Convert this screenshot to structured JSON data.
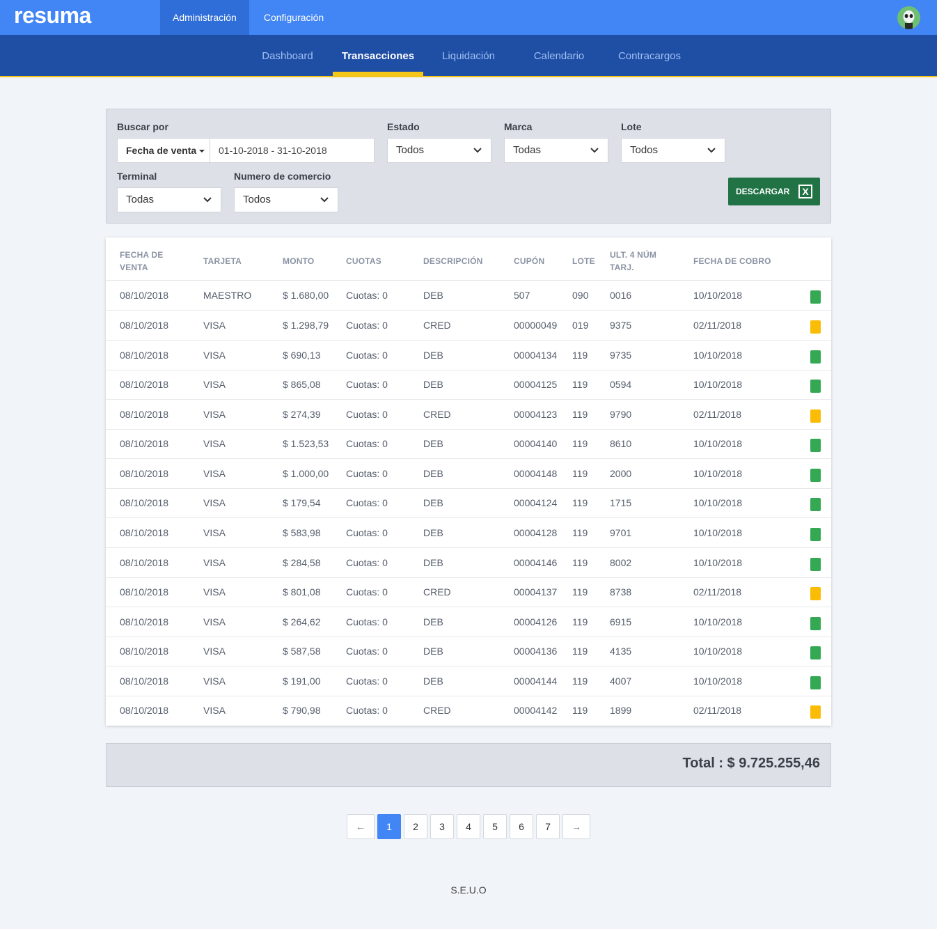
{
  "app": {
    "logo": "resuma"
  },
  "topnav": [
    {
      "label": "Administración",
      "active": true
    },
    {
      "label": "Configuración",
      "active": false
    }
  ],
  "subnav": [
    {
      "label": "Dashboard",
      "active": false
    },
    {
      "label": "Transacciones",
      "active": true
    },
    {
      "label": "Liquidación",
      "active": false
    },
    {
      "label": "Calendario",
      "active": false
    },
    {
      "label": "Contracargos",
      "active": false
    }
  ],
  "filters": {
    "buscar_label": "Buscar por",
    "buscar_by": "Fecha de venta",
    "date_range": "01-10-2018 - 31-10-2018",
    "estado_label": "Estado",
    "estado_value": "Todos",
    "marca_label": "Marca",
    "marca_value": "Todas",
    "lote_label": "Lote",
    "lote_value": "Todos",
    "terminal_label": "Terminal",
    "terminal_value": "Todas",
    "comercio_label": "Numero de comercio",
    "comercio_value": "Todos",
    "download_label": "DESCARGAR",
    "download_icon": "X"
  },
  "table": {
    "headers": {
      "fecha_venta_1": "FECHA DE",
      "fecha_venta_2": "VENTA",
      "tarjeta": "TARJETA",
      "monto": "MONTO",
      "cuotas": "CUOTAS",
      "descripcion": "DESCRIPCIÓN",
      "cupon": "CUPÓN",
      "lote": "LOTE",
      "ult4_1": "ULT. 4 NÚM",
      "ult4_2": "TARJ.",
      "fecha_cobro": "FECHA DE COBRO"
    },
    "rows": [
      {
        "fecha": "08/10/2018",
        "tarjeta": "MAESTRO",
        "monto": "$ 1.680,00",
        "cuotas": "Cuotas: 0",
        "desc": "DEB",
        "cupon": "507",
        "lote": "090",
        "ult4": "0016",
        "cobro": "10/10/2018",
        "status": "green"
      },
      {
        "fecha": "08/10/2018",
        "tarjeta": "VISA",
        "monto": "$ 1.298,79",
        "cuotas": "Cuotas: 0",
        "desc": "CRED",
        "cupon": "00000049",
        "lote": "019",
        "ult4": "9375",
        "cobro": "02/11/2018",
        "status": "yellow"
      },
      {
        "fecha": "08/10/2018",
        "tarjeta": "VISA",
        "monto": "$ 690,13",
        "cuotas": "Cuotas: 0",
        "desc": "DEB",
        "cupon": "00004134",
        "lote": "119",
        "ult4": "9735",
        "cobro": "10/10/2018",
        "status": "green"
      },
      {
        "fecha": "08/10/2018",
        "tarjeta": "VISA",
        "monto": "$ 865,08",
        "cuotas": "Cuotas: 0",
        "desc": "DEB",
        "cupon": "00004125",
        "lote": "119",
        "ult4": "0594",
        "cobro": "10/10/2018",
        "status": "green"
      },
      {
        "fecha": "08/10/2018",
        "tarjeta": "VISA",
        "monto": "$ 274,39",
        "cuotas": "Cuotas: 0",
        "desc": "CRED",
        "cupon": "00004123",
        "lote": "119",
        "ult4": "9790",
        "cobro": "02/11/2018",
        "status": "yellow"
      },
      {
        "fecha": "08/10/2018",
        "tarjeta": "VISA",
        "monto": "$ 1.523,53",
        "cuotas": "Cuotas: 0",
        "desc": "DEB",
        "cupon": "00004140",
        "lote": "119",
        "ult4": "8610",
        "cobro": "10/10/2018",
        "status": "green"
      },
      {
        "fecha": "08/10/2018",
        "tarjeta": "VISA",
        "monto": "$ 1.000,00",
        "cuotas": "Cuotas: 0",
        "desc": "DEB",
        "cupon": "00004148",
        "lote": "119",
        "ult4": "2000",
        "cobro": "10/10/2018",
        "status": "green"
      },
      {
        "fecha": "08/10/2018",
        "tarjeta": "VISA",
        "monto": "$ 179,54",
        "cuotas": "Cuotas: 0",
        "desc": "DEB",
        "cupon": "00004124",
        "lote": "119",
        "ult4": "1715",
        "cobro": "10/10/2018",
        "status": "green"
      },
      {
        "fecha": "08/10/2018",
        "tarjeta": "VISA",
        "monto": "$ 583,98",
        "cuotas": "Cuotas: 0",
        "desc": "DEB",
        "cupon": "00004128",
        "lote": "119",
        "ult4": "9701",
        "cobro": "10/10/2018",
        "status": "green"
      },
      {
        "fecha": "08/10/2018",
        "tarjeta": "VISA",
        "monto": "$ 284,58",
        "cuotas": "Cuotas: 0",
        "desc": "DEB",
        "cupon": "00004146",
        "lote": "119",
        "ult4": "8002",
        "cobro": "10/10/2018",
        "status": "green"
      },
      {
        "fecha": "08/10/2018",
        "tarjeta": "VISA",
        "monto": "$ 801,08",
        "cuotas": "Cuotas: 0",
        "desc": "CRED",
        "cupon": "00004137",
        "lote": "119",
        "ult4": "8738",
        "cobro": "02/11/2018",
        "status": "yellow"
      },
      {
        "fecha": "08/10/2018",
        "tarjeta": "VISA",
        "monto": "$ 264,62",
        "cuotas": "Cuotas: 0",
        "desc": "DEB",
        "cupon": "00004126",
        "lote": "119",
        "ult4": "6915",
        "cobro": "10/10/2018",
        "status": "green"
      },
      {
        "fecha": "08/10/2018",
        "tarjeta": "VISA",
        "monto": "$ 587,58",
        "cuotas": "Cuotas: 0",
        "desc": "DEB",
        "cupon": "00004136",
        "lote": "119",
        "ult4": "4135",
        "cobro": "10/10/2018",
        "status": "green"
      },
      {
        "fecha": "08/10/2018",
        "tarjeta": "VISA",
        "monto": "$ 191,00",
        "cuotas": "Cuotas: 0",
        "desc": "DEB",
        "cupon": "00004144",
        "lote": "119",
        "ult4": "4007",
        "cobro": "10/10/2018",
        "status": "green"
      },
      {
        "fecha": "08/10/2018",
        "tarjeta": "VISA",
        "monto": "$ 790,98",
        "cuotas": "Cuotas: 0",
        "desc": "CRED",
        "cupon": "00004142",
        "lote": "119",
        "ult4": "1899",
        "cobro": "02/11/2018",
        "status": "yellow"
      }
    ]
  },
  "status_colors": {
    "green": "#34a853",
    "yellow": "#fbbc05"
  },
  "total": {
    "text": "Total : $ 9.725.255,46"
  },
  "pagination": {
    "prev": "←",
    "pages": [
      "1",
      "2",
      "3",
      "4",
      "5",
      "6",
      "7"
    ],
    "current": "1",
    "next": "→"
  },
  "footer": {
    "text": "S.E.U.O"
  }
}
